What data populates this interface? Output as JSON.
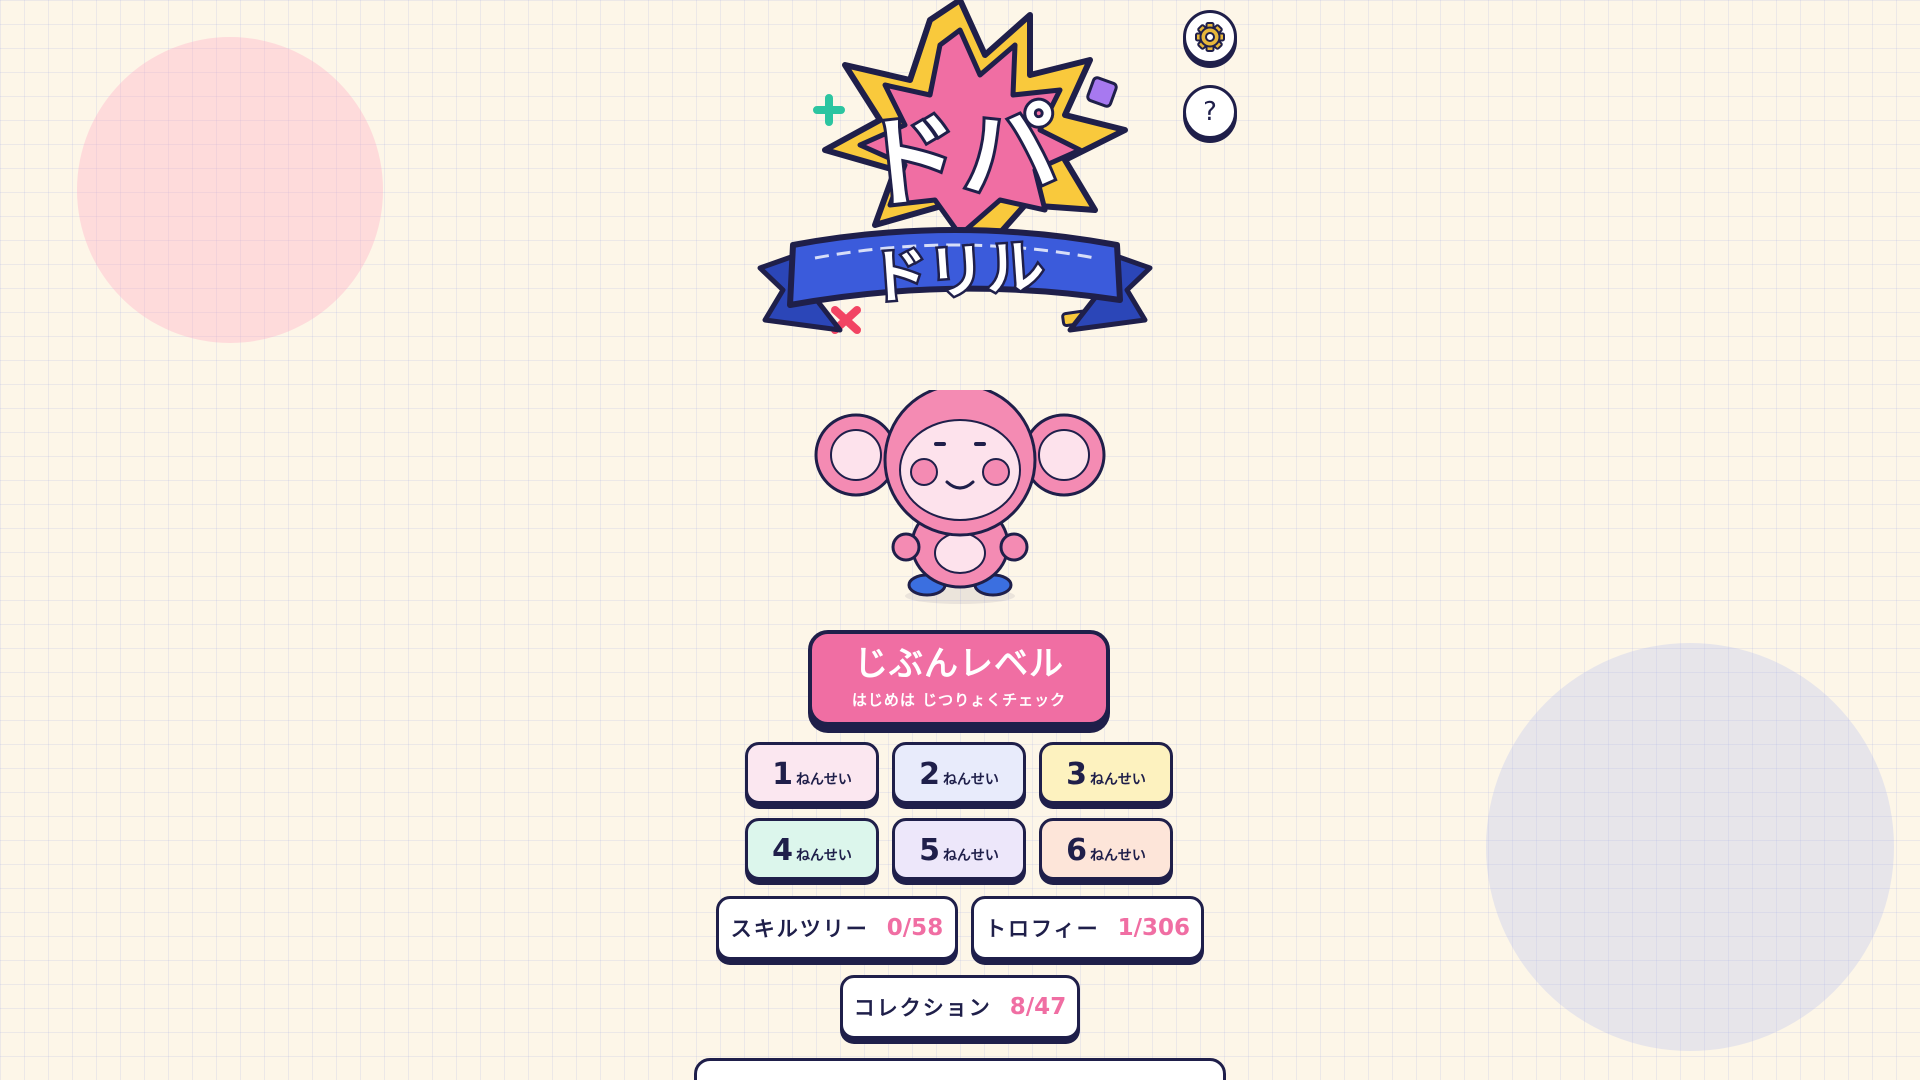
{
  "logo": {
    "title_top": "ドパ",
    "title_ribbon": "ドリル"
  },
  "header": {
    "settings_icon": "gear-icon",
    "help_label": "?"
  },
  "mascot": {
    "name": "pink-monkey-mascot"
  },
  "main_button": {
    "title": "じぶんレベル",
    "subtitle": "はじめは じつりょくチェック"
  },
  "grades": [
    {
      "num": "1",
      "suffix": "ねんせい",
      "color": "#fbe7f0"
    },
    {
      "num": "2",
      "suffix": "ねんせい",
      "color": "#e8ebfb"
    },
    {
      "num": "3",
      "suffix": "ねんせい",
      "color": "#fdf2bf"
    },
    {
      "num": "4",
      "suffix": "ねんせい",
      "color": "#dcf6ec"
    },
    {
      "num": "5",
      "suffix": "ねんせい",
      "color": "#ede7fa"
    },
    {
      "num": "6",
      "suffix": "ねんせい",
      "color": "#fde5d9"
    }
  ],
  "stats": {
    "skill_tree": {
      "label": "スキルツリー",
      "value": "0/58"
    },
    "trophy": {
      "label": "トロフィー",
      "value": "1/306"
    },
    "collection": {
      "label": "コレクション",
      "value": "8/47"
    }
  },
  "colors": {
    "accent_pink": "#f06ea3",
    "ink": "#1f1f4a",
    "ribbon_blue": "#3b5bdb",
    "burst_yellow": "#f9c93c",
    "background": "#fdf6e8"
  }
}
